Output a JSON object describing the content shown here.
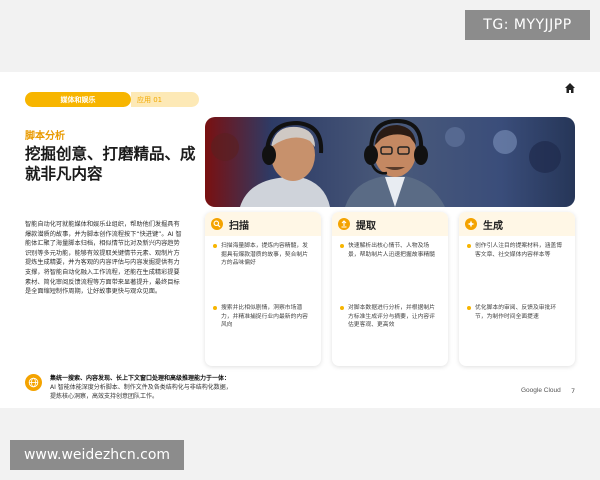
{
  "overlay": {
    "tg_label": "TG: MYYJJPP",
    "watermark": "www.weidezhcn.com"
  },
  "slide": {
    "tag_primary": "媒体和娱乐",
    "tag_secondary": "应用 01",
    "kicker": "脚本分析",
    "headline": "挖掘创意、打磨精品、成就非凡内容",
    "body": "智能自动化可就能媒体和娱乐业组织，帮助他们发掘具有爆款潜质的故事，并为脚本创作流程按下“快进键”。AI 智能体汇聚了海量脚本归档，相似情节比对及新兴内容趋势识别等多元功能，能够有效提取关键情节元素、观制片方提炼生成精要，并为客观的内容评估与内容发掘提供有力支撑，将智能自动化融入工作流程，还能在生成精彩提要素材、简化审阅反馈流程等方面带来显著提升，最终目标是全面缩短制作周期，让好故事更快与观众见面。",
    "cards": [
      {
        "title": "扫描",
        "icon": "search-icon",
        "bullets": [
          "扫描海量脚本，提炼内容精髓，发掘具有爆款潜质的故事，契合制片方的品味偏好",
          "搜索并比相似剧情，洞察市场潜力，并精准捕捉行业内最新的内容风向"
        ]
      },
      {
        "title": "提取",
        "icon": "upload-icon",
        "bullets": [
          "快速解析出核心情节、人物及场景，帮助制片人迅速把握故事精髓",
          "对脚本数据进行分析，并根据制片方标准生成评分与摘要，让内容评估更客观、更高效"
        ]
      },
      {
        "title": "生成",
        "icon": "sparkle-icon",
        "bullets": [
          "创作引人注目的提案材料，涵盖博客文章、社交媒体内容样本等",
          "优化脚本的审阅、反馈及审批环节，为制作时间全面提速"
        ]
      }
    ],
    "footer_bold": "集统一搜索、内容发现、长上下文窗口处理和高级推理能力于一体：",
    "footer_rest": "AI 智能体能深度分析脚本、制作文件及各类结构化与非结构化数据，提炼核心洞察，高效支持创意团队工作。",
    "brand": "Google Cloud",
    "page_number": "7"
  },
  "colors": {
    "accent": "#f7b500",
    "accent_light": "#fde9b6",
    "kicker": "#e99a00"
  }
}
